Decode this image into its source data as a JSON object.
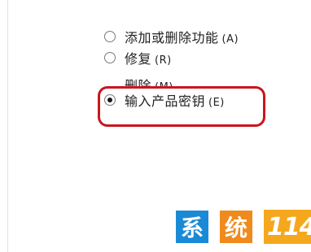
{
  "options": [
    {
      "label": "添加或删除功能",
      "key": "(A)",
      "checked": false
    },
    {
      "label": "修复",
      "key": "(R)",
      "checked": false
    },
    {
      "label": "删除",
      "key": "(M)",
      "checked": false
    },
    {
      "label": "输入产品密钥",
      "key": "(E)",
      "checked": true
    }
  ],
  "highlight_color": "#c8161d",
  "watermark": {
    "char1": "系",
    "char2": "统",
    "number": "114",
    "colors": {
      "char1_bg": "#1a8ad6",
      "char2_bg": "#f08a1c",
      "number_bg": "#f5a81e"
    }
  }
}
